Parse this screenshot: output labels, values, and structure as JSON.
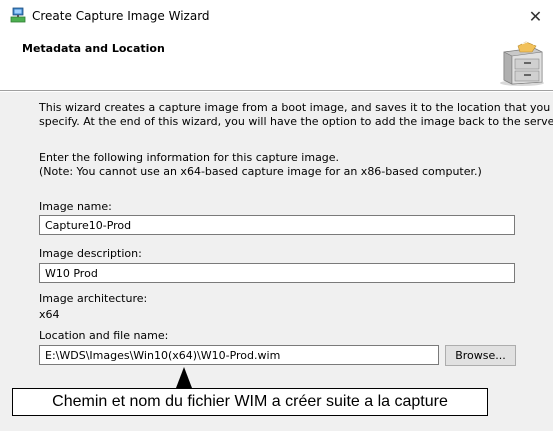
{
  "window": {
    "title": "Create Capture Image Wizard",
    "close_glyph": "✕"
  },
  "header": {
    "title": "Metadata and Location",
    "icon": "file-cabinet-icon"
  },
  "intro": {
    "line1": "This wizard creates a capture image from a boot image, and saves it to the location that you",
    "line2": "specify. At the end of this wizard, you will have the option to add the image back to the server."
  },
  "instructions": {
    "line1": "Enter the following information for this capture image.",
    "line2": "(Note: You cannot use an x64-based capture image for an x86-based computer.)"
  },
  "form": {
    "image_name_label": "Image name:",
    "image_name_value": "Capture10-Prod",
    "image_description_label": "Image description:",
    "image_description_value": "W10 Prod",
    "architecture_label": "Image architecture:",
    "architecture_value": "x64",
    "location_label": "Location and file name:",
    "location_value": "E:\\WDS\\Images\\Win10(x64)\\W10-Prod.wim",
    "browse_label": "Browse..."
  },
  "annotation": {
    "text": "Chemin et nom du fichier WIM a créer suite a la capture"
  }
}
